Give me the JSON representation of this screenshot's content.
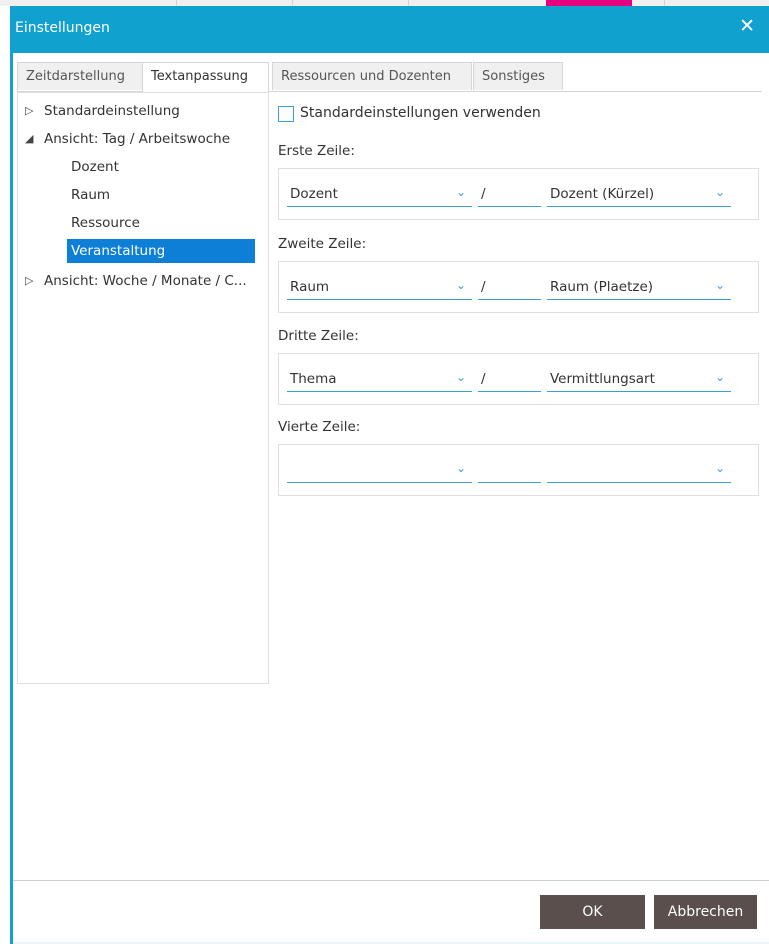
{
  "window": {
    "title": "Einstellungen"
  },
  "tabs": [
    {
      "label": "Zeitdarstellung",
      "active": false
    },
    {
      "label": "Textanpassung",
      "active": true
    },
    {
      "label": "Ressourcen und Dozenten",
      "active": false
    },
    {
      "label": "Sonstiges",
      "active": false
    }
  ],
  "tree": {
    "items": [
      {
        "label": "Standardeinstellung",
        "expanded": false
      },
      {
        "label": "Ansicht: Tag / Arbeitswoche",
        "expanded": true
      },
      {
        "label": "Dozent"
      },
      {
        "label": "Raum"
      },
      {
        "label": "Ressource"
      },
      {
        "label": "Veranstaltung",
        "selected": true
      },
      {
        "label": "Ansicht: Woche / Monate / C...",
        "expanded": false
      }
    ],
    "arrow_collapsed": "▷",
    "arrow_expanded": "◢"
  },
  "settings": {
    "use_defaults_label": "Standardeinstellungen verwenden",
    "use_defaults_checked": false,
    "rows": [
      {
        "label": "Erste Zeile:",
        "first": "Dozent",
        "separator": "/",
        "second": "Dozent (Kürzel)"
      },
      {
        "label": "Zweite Zeile:",
        "first": "Raum",
        "separator": "/",
        "second": "Raum (Plaetze)"
      },
      {
        "label": "Dritte Zeile:",
        "first": "Thema",
        "separator": "/",
        "second": "Vermittlungsart"
      },
      {
        "label": "Vierte Zeile:",
        "first": "",
        "separator": "",
        "second": ""
      }
    ],
    "chevron": "⌄"
  },
  "buttons": {
    "ok": "OK",
    "cancel": "Abbrechen"
  },
  "colors": {
    "accent": "#10a1ce",
    "selection": "#0d7fd6",
    "button": "#5a4f4c",
    "highlight_tab": "#e4007f"
  }
}
